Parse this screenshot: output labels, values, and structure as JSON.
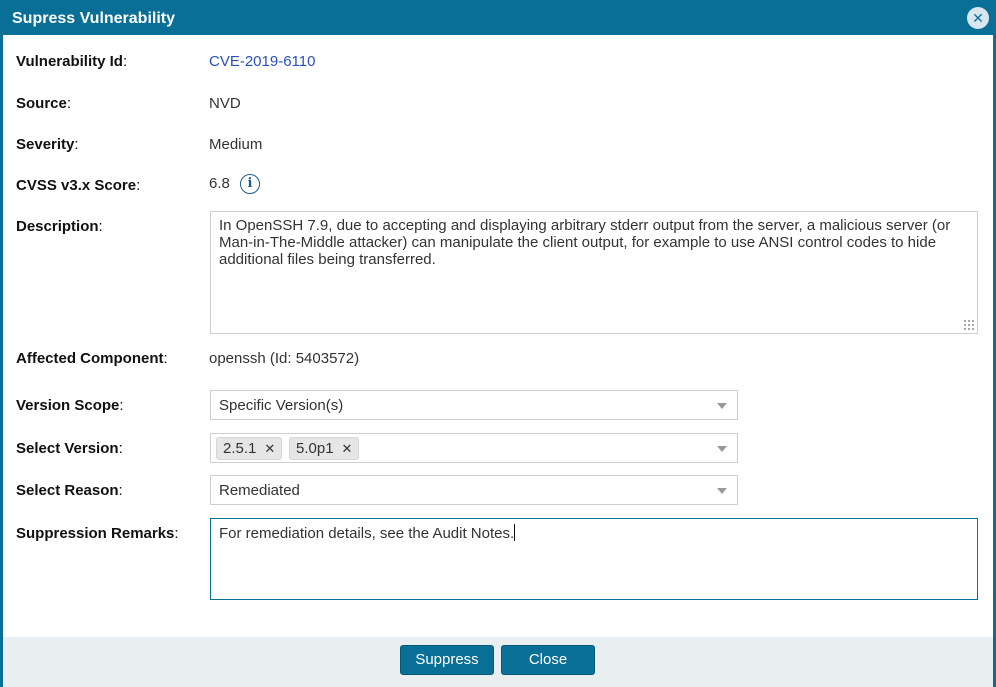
{
  "dialog": {
    "title": "Supress Vulnerability",
    "close_symbol": "✕"
  },
  "fields": {
    "vulnerability_id": {
      "label": "Vulnerability Id",
      "value": "CVE-2019-6110"
    },
    "source": {
      "label": "Source",
      "value": "NVD"
    },
    "severity": {
      "label": "Severity",
      "value": "Medium"
    },
    "cvss": {
      "label": "CVSS v3.x Score",
      "value": "6.8",
      "info_icon": "info-icon",
      "info_glyph": "i"
    },
    "description": {
      "label": "Description",
      "value": "In OpenSSH 7.9, due to accepting and displaying arbitrary stderr output from the server, a malicious server (or Man-in-The-Middle attacker) can manipulate the client output, for example to use ANSI control codes to hide additional files being transferred."
    },
    "affected_component": {
      "label": "Affected Component",
      "value": "openssh (Id: 5403572)"
    },
    "version_scope": {
      "label": "Version Scope",
      "selected": "Specific Version(s)"
    },
    "select_version": {
      "label": "Select Version",
      "tags": [
        "2.5.1",
        "5.0p1"
      ],
      "remove_symbol": "✕"
    },
    "select_reason": {
      "label": "Select Reason",
      "selected": "Remediated"
    },
    "suppression_remarks": {
      "label": "Suppression Remarks",
      "value": "For remediation details, see the Audit Notes."
    }
  },
  "colon": ":",
  "buttons": {
    "suppress": "Suppress",
    "close": "Close"
  },
  "colors": {
    "accent": "#0a6f96",
    "link": "#2a4fbf",
    "footer_bg": "#e9eef1"
  }
}
